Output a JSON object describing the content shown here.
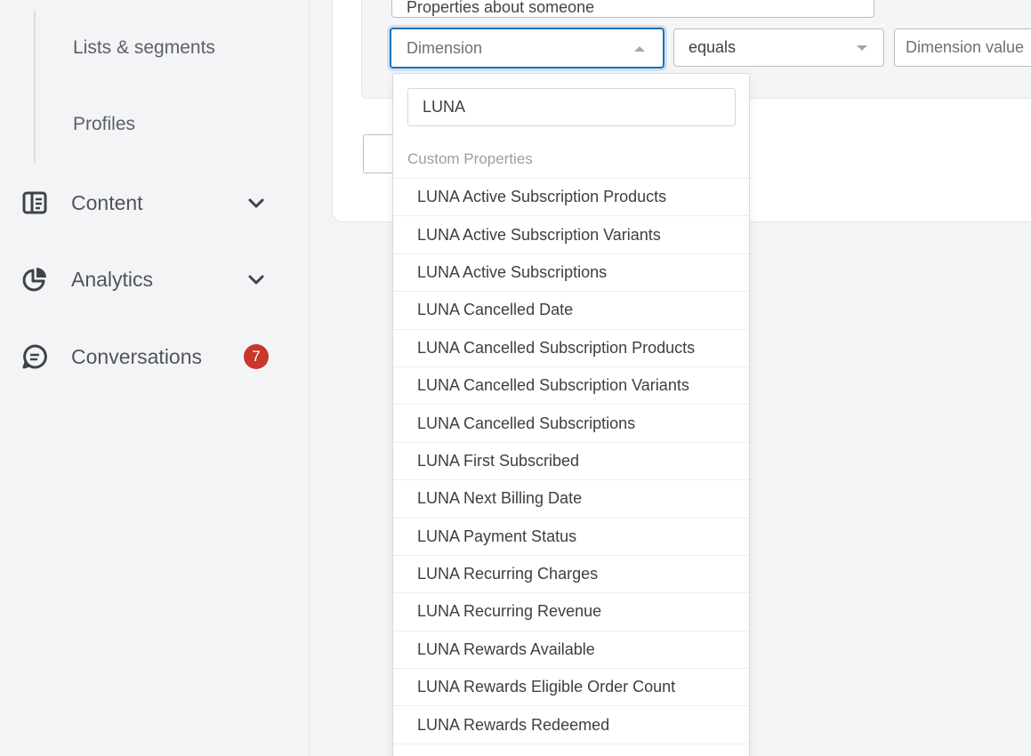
{
  "sidebar": {
    "sub_items": [
      "Lists & segments",
      "Profiles"
    ],
    "nav": [
      {
        "label": "Content",
        "icon": "document-icon"
      },
      {
        "label": "Analytics",
        "icon": "pie-chart-icon"
      },
      {
        "label": "Conversations",
        "icon": "chat-icon",
        "badge": "7"
      }
    ]
  },
  "filter": {
    "top_select": "Properties about someone",
    "dimension_placeholder": "Dimension",
    "operator": "equals",
    "value_placeholder": "Dimension value"
  },
  "dropdown": {
    "search_value": "LUNA",
    "group_label": "Custom Properties",
    "options": [
      "LUNA Active Subscription Products",
      "LUNA Active Subscription Variants",
      "LUNA Active Subscriptions",
      "LUNA Cancelled Date",
      "LUNA Cancelled Subscription Products",
      "LUNA Cancelled Subscription Variants",
      "LUNA Cancelled Subscriptions",
      "LUNA First Subscribed",
      "LUNA Next Billing Date",
      "LUNA Payment Status",
      "LUNA Recurring Charges",
      "LUNA Recurring Revenue",
      "LUNA Rewards Available",
      "LUNA Rewards Eligible Order Count",
      "LUNA Rewards Redeemed"
    ]
  },
  "colors": {
    "accent": "#1f6fb2",
    "badge": "#c8372a"
  }
}
